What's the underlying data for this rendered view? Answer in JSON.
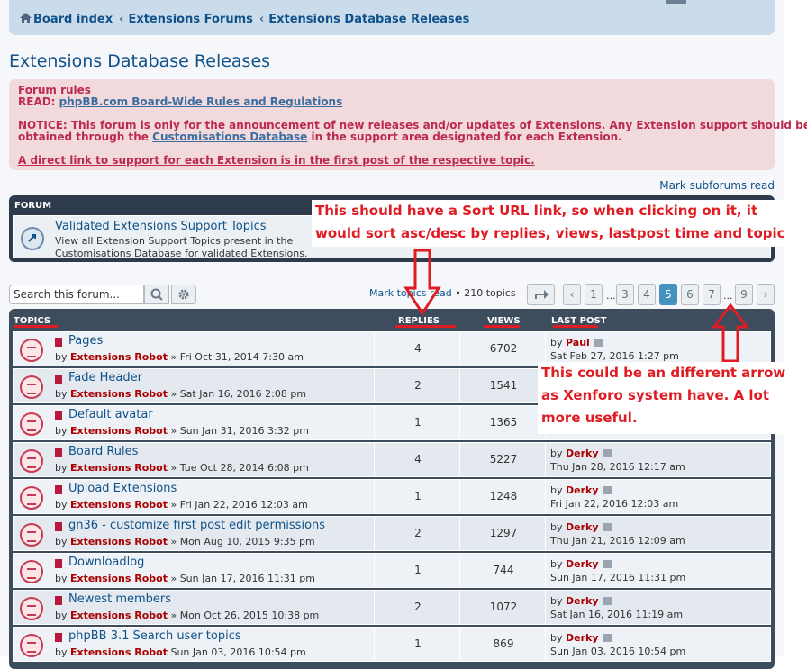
{
  "breadcrumb": {
    "items": [
      "Board index",
      "Extensions Forums",
      "Extensions Database Releases"
    ]
  },
  "page_title": "Extensions Database Releases",
  "rules": {
    "heading": "Forum rules",
    "read_prefix": "READ:",
    "read_link": "phpBB.com Board-Wide Rules and Regulations",
    "notice1": "NOTICE: This forum is only for the announcement of new releases and/or updates of Extensions. Any Extension support should be",
    "notice2_pre": "obtained through the",
    "notice2_link": "Customisations Database",
    "notice2_post": "in the support area designated for each Extension.",
    "direct_link": "A direct link to support for each Extension is in the first post of the respective topic."
  },
  "mark_subforums": "Mark subforums read",
  "forum": {
    "header": "FORUM",
    "title": "Validated Extensions Support Topics",
    "desc": "View all Extension Support Topics present in the Customisations Database for validated Extensions."
  },
  "annotations": {
    "note1_line1": "This should have a Sort URL link, so when clicking on it, it",
    "note1_line2": "would sort asc/desc by replies, views, lastpost time and topic",
    "note2_line1": "This could be an different arrow",
    "note2_line2": "as Xenforo system have. A lot",
    "note2_line3": "more useful.",
    "color": "#e01b22"
  },
  "toolbar": {
    "search_value": "Search this forum...",
    "mark_topics": "Mark topics read",
    "topic_count": "• 210 topics",
    "pages": [
      "1",
      "...",
      "3",
      "4",
      "5",
      "6",
      "7",
      "...",
      "9"
    ],
    "current_page": "5"
  },
  "table": {
    "headers": {
      "topics": "TOPICS",
      "replies": "REPLIES",
      "views": "VIEWS",
      "last_post": "LAST POST"
    },
    "rows": [
      {
        "title": "Pages",
        "author": "Extensions Robot",
        "date": "» Fri Oct 31, 2014 7:30 am",
        "replies": "4",
        "views": "6702",
        "lp_user": "Paul",
        "lp_date": "Sat Feb 27, 2016 1:27 pm"
      },
      {
        "title": "Fade Header",
        "author": "Extensions Robot",
        "date": "» Sat Jan 16, 2016 2:08 pm",
        "replies": "2",
        "views": "1541",
        "lp_user": "",
        "lp_date": ""
      },
      {
        "title": "Default avatar",
        "author": "Extensions Robot",
        "date": "» Sun Jan 31, 2016 3:32 pm",
        "replies": "1",
        "views": "1365",
        "lp_user": "",
        "lp_date": ""
      },
      {
        "title": "Board Rules",
        "author": "Extensions Robot",
        "date": "» Tue Oct 28, 2014 6:08 pm",
        "replies": "4",
        "views": "5227",
        "lp_user": "Derky",
        "lp_date": "Thu Jan 28, 2016 12:17 am"
      },
      {
        "title": "Upload Extensions",
        "author": "Extensions Robot",
        "date": "» Fri Jan 22, 2016 12:03 am",
        "replies": "1",
        "views": "1248",
        "lp_user": "Derky",
        "lp_date": "Fri Jan 22, 2016 12:03 am"
      },
      {
        "title": "gn36 - customize first post edit permissions",
        "author": "Extensions Robot",
        "date": "» Mon Aug 10, 2015 9:35 pm",
        "replies": "2",
        "views": "1297",
        "lp_user": "Derky",
        "lp_date": "Thu Jan 21, 2016 12:09 am"
      },
      {
        "title": "Downloadlog",
        "author": "Extensions Robot",
        "date": "» Sun Jan 17, 2016 11:31 pm",
        "replies": "1",
        "views": "744",
        "lp_user": "Derky",
        "lp_date": "Sun Jan 17, 2016 11:31 pm"
      },
      {
        "title": "Newest members",
        "author": "Extensions Robot",
        "date": "» Mon Oct 26, 2015 10:38 pm",
        "replies": "2",
        "views": "1072",
        "lp_user": "Derky",
        "lp_date": "Sat Jan 16, 2016 11:19 am"
      },
      {
        "title": "phpBB 3.1 Search user topics",
        "author": "Extensions Robot",
        "date": "Sun Jan 03, 2016 10:54 pm",
        "replies": "1",
        "views": "869",
        "lp_user": "Derky",
        "lp_date": "Sun Jan 03, 2016 10:54 pm"
      }
    ],
    "by_prefix": "by"
  }
}
